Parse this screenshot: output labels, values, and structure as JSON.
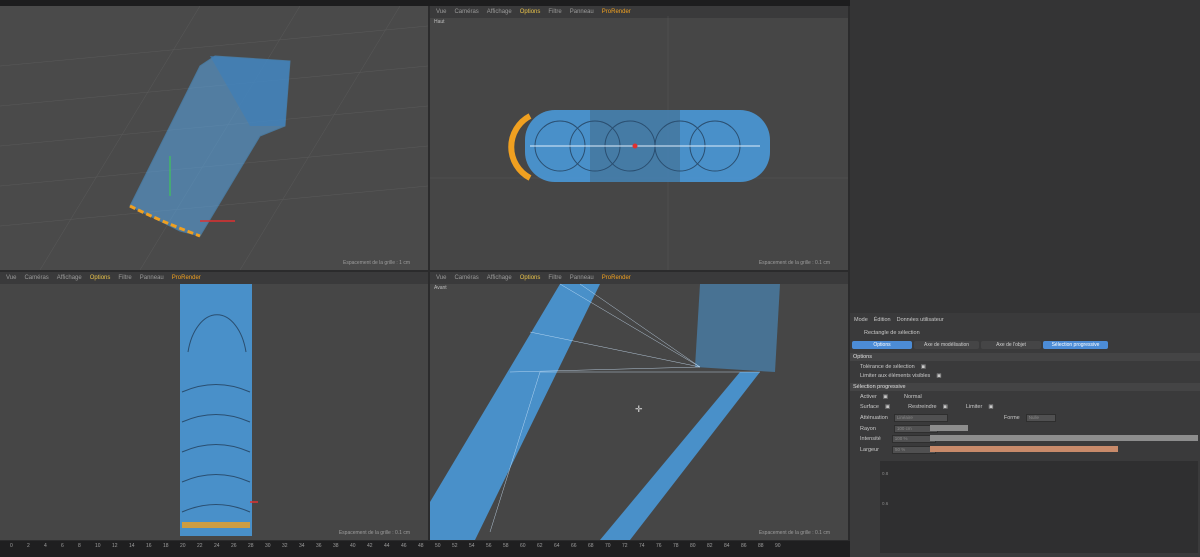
{
  "viewport_menu": [
    "Vue",
    "Caméras",
    "Affichage",
    "Options",
    "Filtre",
    "Panneau",
    "ProRender"
  ],
  "viewports": {
    "top_left": {
      "grid_label": "Espacement de la grille : 1 cm"
    },
    "top_right": {
      "cam": "Haut",
      "grid_label": "Espacement de la grille : 0.1 cm"
    },
    "bottom_left": {
      "grid_label": "Espacement de la grille : 0.1 cm"
    },
    "bottom_right": {
      "cam": "Avant",
      "grid_label": "Espacement de la grille : 0.1 cm"
    }
  },
  "attributes": {
    "menu": [
      "Mode",
      "Édition",
      "Données utilisateur"
    ],
    "tool_title": "Rectangle de sélection",
    "tabs": [
      "Options",
      "Axe de modélisation",
      "Axe de l'objet",
      "Sélection progressive"
    ],
    "section_options": "Options",
    "opt1": "Tolérance de sélection",
    "opt2": "Limiter aux éléments visibles",
    "section_progressive": "Sélection progressive",
    "activer": "Activer",
    "mode_value": "Normal",
    "surface": "Surface",
    "restreindre": "Restreindre",
    "limiter": "Limiter",
    "attenuation": "Atténuation",
    "attenuation_value": "Linéaire",
    "forme": "Forme",
    "forme_value": "Nulle",
    "rayon": "Rayon",
    "rayon_value": "100 cm",
    "intensite": "Intensité",
    "intensite_value": "100 %",
    "largeur": "Largeur",
    "largeur_value": "50 %",
    "graph_y1": "0.8",
    "graph_y2": "0.6"
  },
  "timeline_ticks": [
    "0",
    "2",
    "4",
    "6",
    "8",
    "10",
    "12",
    "14",
    "16",
    "18",
    "20",
    "22",
    "24",
    "26",
    "28",
    "30",
    "32",
    "34",
    "36",
    "38",
    "40",
    "42",
    "44",
    "46",
    "48",
    "50",
    "52",
    "54",
    "56",
    "58",
    "60",
    "62",
    "64",
    "66",
    "68",
    "70",
    "72",
    "74",
    "76",
    "78",
    "80",
    "82",
    "84",
    "86",
    "88",
    "90"
  ],
  "colors": {
    "selection": "#4a9ee0",
    "highlight": "#f0a020",
    "accent": "#4c8cd6"
  }
}
